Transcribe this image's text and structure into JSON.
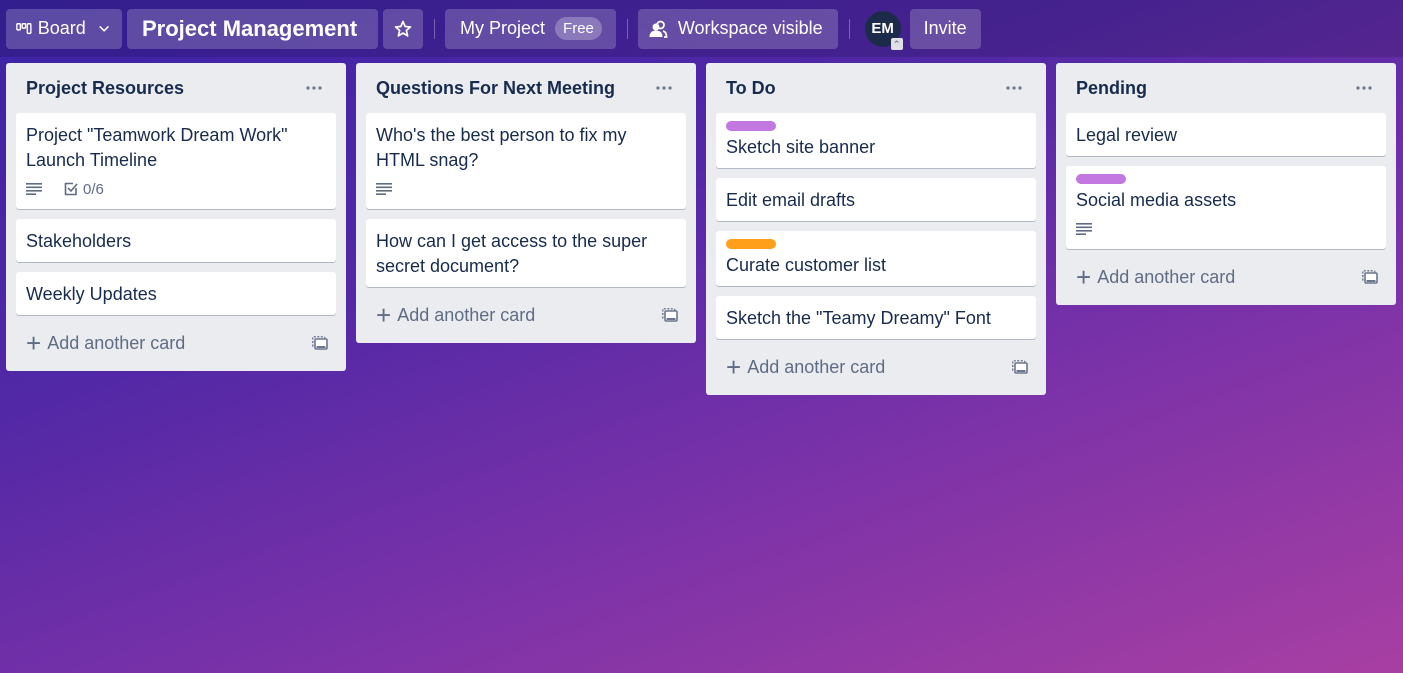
{
  "header": {
    "view_button": {
      "label": "Board",
      "icon": "board-icon"
    },
    "board_title": "Project Management",
    "star_icon": "star-icon",
    "workspace": {
      "label": "My Project",
      "badge": "Free"
    },
    "visibility": {
      "label": "Workspace visible",
      "icon": "workspace-visible-icon"
    },
    "member_avatar": {
      "initials": "EM"
    },
    "invite_label": "Invite"
  },
  "colors": {
    "label_purple": "#c377e0",
    "label_orange": "#ff9f1a"
  },
  "lists": [
    {
      "title": "Project Resources",
      "cards": [
        {
          "title": "Project \"Teamwork Dream Work\" Launch Timeline",
          "has_description": true,
          "checklist": "0/6"
        },
        {
          "title": "Stakeholders"
        },
        {
          "title": "Weekly Updates"
        }
      ],
      "add_label": "Add another card"
    },
    {
      "title": "Questions For Next Meeting",
      "cards": [
        {
          "title": "Who's the best person to fix my HTML snag?",
          "has_description": true
        },
        {
          "title": "How can I get access to the super secret document?"
        }
      ],
      "add_label": "Add another card"
    },
    {
      "title": "To Do",
      "cards": [
        {
          "title": "Sketch site banner",
          "label": "purple"
        },
        {
          "title": "Edit email drafts"
        },
        {
          "title": "Curate customer list",
          "label": "orange"
        },
        {
          "title": "Sketch the \"Teamy Dreamy\" Font"
        }
      ],
      "add_label": "Add another card"
    },
    {
      "title": "Pending",
      "cards": [
        {
          "title": "Legal review"
        },
        {
          "title": "Social media assets",
          "label": "purple",
          "has_description": true
        }
      ],
      "add_label": "Add another card"
    }
  ]
}
